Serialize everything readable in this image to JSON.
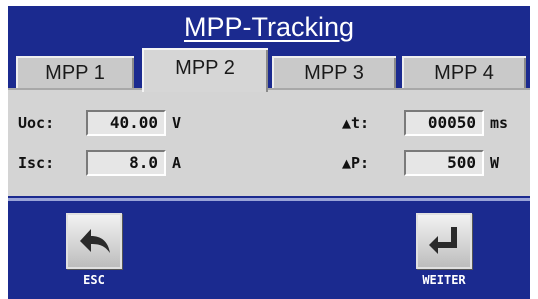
{
  "title": "MPP-Tracking",
  "tabs": [
    {
      "label": "MPP 1",
      "active": false
    },
    {
      "label": "MPP 2",
      "active": true
    },
    {
      "label": "MPP 3",
      "active": false
    },
    {
      "label": "MPP 4",
      "active": false
    }
  ],
  "fields": {
    "uoc": {
      "label": "Uoc:",
      "value": "40.00",
      "unit": "V"
    },
    "isc": {
      "label": "Isc:",
      "value": "8.0",
      "unit": "A"
    },
    "dt": {
      "label": "▲t:",
      "value": "00050",
      "unit": "ms"
    },
    "dp": {
      "label": "▲P:",
      "value": "500",
      "unit": "W"
    }
  },
  "buttons": {
    "esc": {
      "label": "ESC",
      "icon": "back-arrow-icon"
    },
    "weiter": {
      "label": "WEITER",
      "icon": "enter-return-icon"
    }
  },
  "colors": {
    "background_blue": "#1b2a8f",
    "panel_gray": "#d4d4d4"
  }
}
